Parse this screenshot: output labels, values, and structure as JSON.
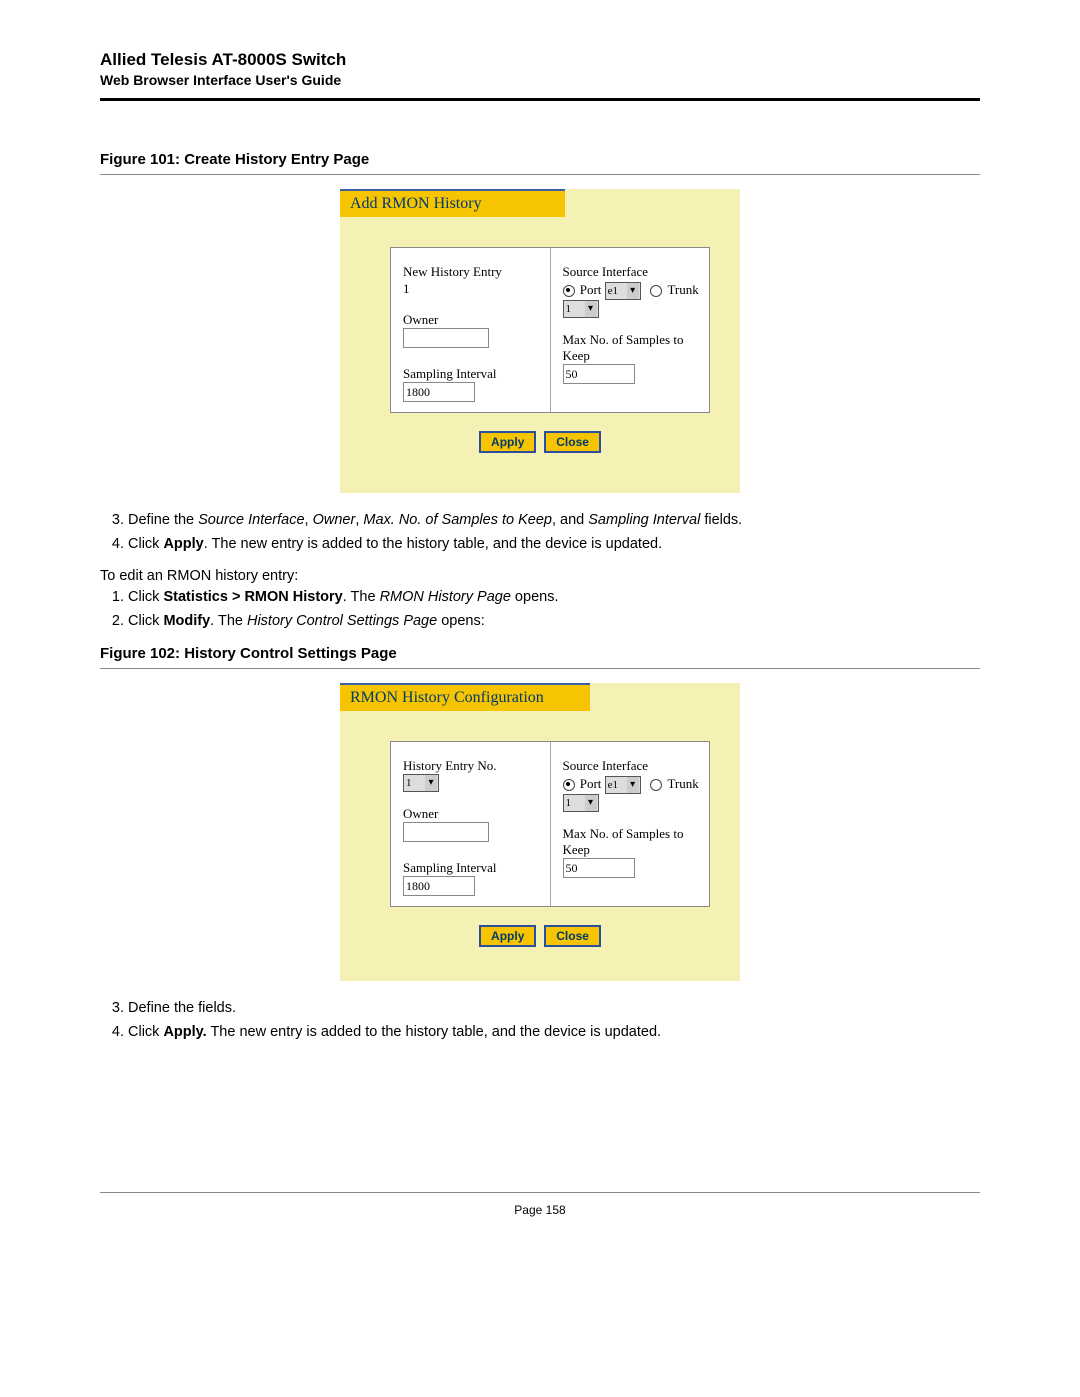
{
  "header": {
    "title": "Allied Telesis AT-8000S Switch",
    "subtitle": "Web Browser Interface User's Guide"
  },
  "figures": {
    "fig101": {
      "caption": "Figure 101: Create History Entry Page",
      "title": "Add RMON History",
      "left": {
        "f1_label": "New History Entry",
        "f1_value": "1",
        "f2_label": "Owner",
        "f2_value": "",
        "f3_label": "Sampling Interval",
        "f3_value": "1800"
      },
      "right": {
        "f1_label": "Source Interface",
        "radio_port": "Port",
        "port_value": "e1",
        "radio_trunk": "Trunk",
        "trunk_value": "1",
        "f2_label": "Max No. of Samples to Keep",
        "f2_value": "50"
      },
      "buttons": {
        "apply": "Apply",
        "close": "Close"
      }
    },
    "fig102": {
      "caption": "Figure 102: History Control Settings Page",
      "title": "RMON History Configuration",
      "left": {
        "f1_label": "History Entry No.",
        "f1_value": "1",
        "f2_label": "Owner",
        "f2_value": "",
        "f3_label": "Sampling Interval",
        "f3_value": "1800"
      },
      "right": {
        "f1_label": "Source Interface",
        "radio_port": "Port",
        "port_value": "e1",
        "radio_trunk": "Trunk",
        "trunk_value": "1",
        "f2_label": "Max No. of Samples to Keep",
        "f2_value": "50"
      },
      "buttons": {
        "apply": "Apply",
        "close": "Close"
      }
    }
  },
  "instructions": {
    "set1_3_a": "Define the ",
    "set1_3_b": "Source Interface",
    "set1_3_c": ", ",
    "set1_3_d": "Owner",
    "set1_3_e": ", ",
    "set1_3_f": "Max. No. of Samples to Keep",
    "set1_3_g": ", and ",
    "set1_3_h": "Sampling Interval",
    "set1_3_i": " fields.",
    "set1_4_a": "Click ",
    "set1_4_b": "Apply",
    "set1_4_c": ". The new entry is added to the history table, and the device is updated.",
    "edit_intro": "To edit an RMON history entry:",
    "set2_1_a": "Click ",
    "set2_1_b": "Statistics > RMON History",
    "set2_1_c": ". The ",
    "set2_1_d": "RMON History Page",
    "set2_1_e": " opens.",
    "set2_2_a": "Click ",
    "set2_2_b": "Modify",
    "set2_2_c": ". The ",
    "set2_2_d": "History Control Settings Page",
    "set2_2_e": " opens:",
    "set3_3": "Define the fields.",
    "set3_4_a": "Click ",
    "set3_4_b": "Apply.",
    "set3_4_c": " The new entry is added to the history table, and the device is updated."
  },
  "footer": {
    "page": "Page 158"
  }
}
